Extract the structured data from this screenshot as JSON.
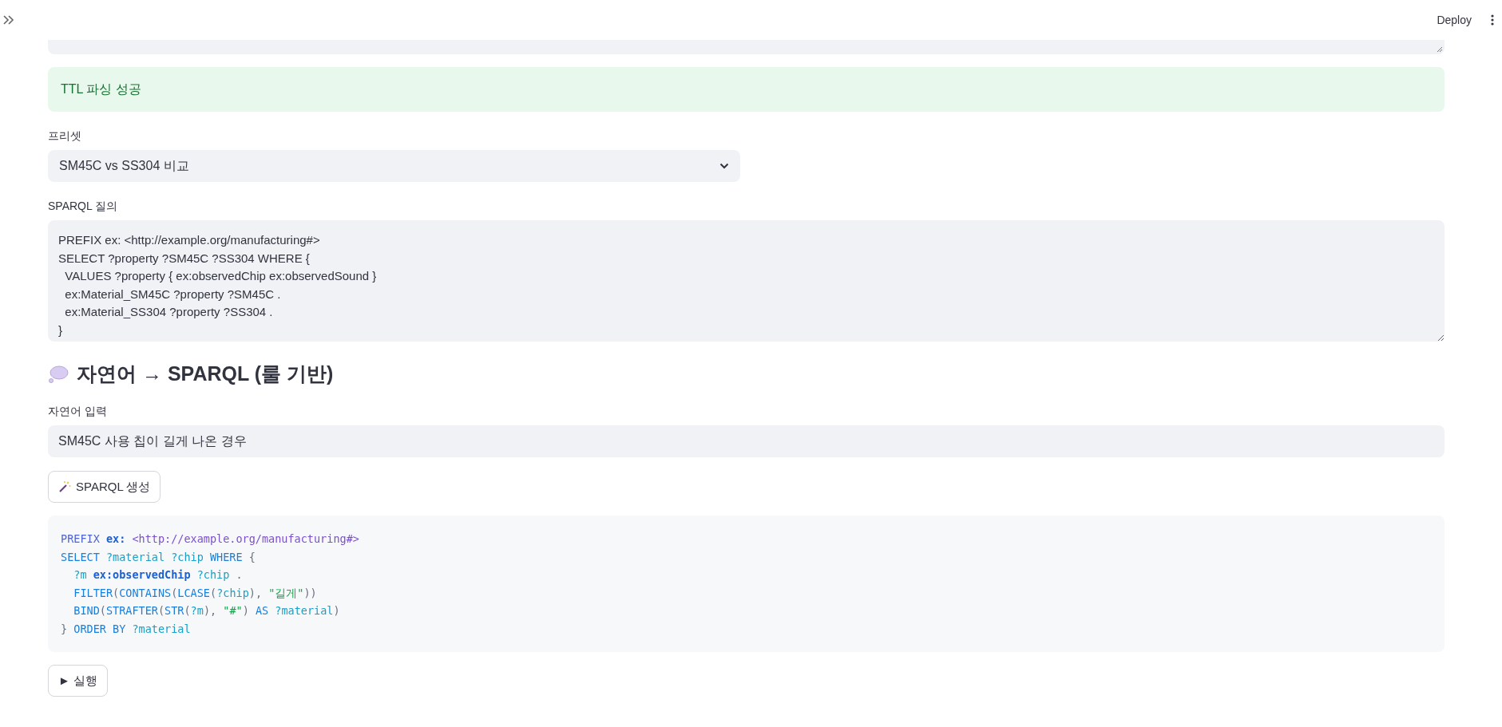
{
  "header": {
    "deploy": "Deploy"
  },
  "success": {
    "message": "TTL 파싱 성공"
  },
  "preset": {
    "label": "프리셋",
    "value": "SM45C vs SS304 비교"
  },
  "query": {
    "label": "SPARQL 질의",
    "value": "PREFIX ex: <http://example.org/manufacturing#>\nSELECT ?property ?SM45C ?SS304 WHERE {\n  VALUES ?property { ex:observedChip ex:observedSound }\n  ex:Material_SM45C ?property ?SM45C .\n  ex:Material_SS304 ?property ?SS304 .\n}"
  },
  "nl_section": {
    "title": "자연어 → SPARQL (룰 기반)"
  },
  "nl_input": {
    "label": "자연어 입력",
    "value": "SM45C 사용 칩이 길게 나온 경우"
  },
  "generate_button": {
    "label": "SPARQL 생성"
  },
  "code": {
    "lines": [
      {
        "indented": false,
        "tokens": [
          {
            "kind": "keyword",
            "text": "PREFIX "
          },
          {
            "kind": "prefix",
            "text": "ex: "
          },
          {
            "kind": "iri",
            "text": "<http://example.org/manufacturing#>"
          }
        ]
      },
      {
        "indented": false,
        "tokens": [
          {
            "kind": "keyword2",
            "text": "SELECT "
          },
          {
            "kind": "var",
            "text": "?material ?chip "
          },
          {
            "kind": "keyword2",
            "text": "WHERE "
          },
          {
            "kind": "punct",
            "text": "{"
          }
        ]
      },
      {
        "indented": true,
        "tokens": [
          {
            "kind": "var",
            "text": "?m "
          },
          {
            "kind": "prefix",
            "text": "ex:observedChip"
          },
          {
            "kind": "var",
            "text": " ?chip "
          },
          {
            "kind": "punct",
            "text": "."
          }
        ]
      },
      {
        "indented": true,
        "tokens": [
          {
            "kind": "keyword2",
            "text": "FILTER"
          },
          {
            "kind": "punct",
            "text": "("
          },
          {
            "kind": "keyword2",
            "text": "CONTAINS"
          },
          {
            "kind": "punct",
            "text": "("
          },
          {
            "kind": "keyword2",
            "text": "LCASE"
          },
          {
            "kind": "punct",
            "text": "("
          },
          {
            "kind": "var",
            "text": "?chip"
          },
          {
            "kind": "punct",
            "text": "), "
          },
          {
            "kind": "string",
            "text": "\"길게\""
          },
          {
            "kind": "punct",
            "text": "))"
          }
        ]
      },
      {
        "indented": true,
        "tokens": [
          {
            "kind": "keyword2",
            "text": "BIND"
          },
          {
            "kind": "punct",
            "text": "("
          },
          {
            "kind": "keyword2",
            "text": "STRAFTER"
          },
          {
            "kind": "punct",
            "text": "("
          },
          {
            "kind": "keyword2",
            "text": "STR"
          },
          {
            "kind": "punct",
            "text": "("
          },
          {
            "kind": "var",
            "text": "?m"
          },
          {
            "kind": "punct",
            "text": "), "
          },
          {
            "kind": "string",
            "text": "\"#\""
          },
          {
            "kind": "punct",
            "text": ") "
          },
          {
            "kind": "keyword2",
            "text": "AS "
          },
          {
            "kind": "var",
            "text": "?material"
          },
          {
            "kind": "punct",
            "text": ")"
          }
        ]
      },
      {
        "indented": false,
        "tokens": [
          {
            "kind": "punct",
            "text": "} "
          },
          {
            "kind": "keyword2",
            "text": "ORDER BY "
          },
          {
            "kind": "var",
            "text": "?material"
          }
        ]
      }
    ]
  },
  "run_button": {
    "label": "► 실행"
  }
}
